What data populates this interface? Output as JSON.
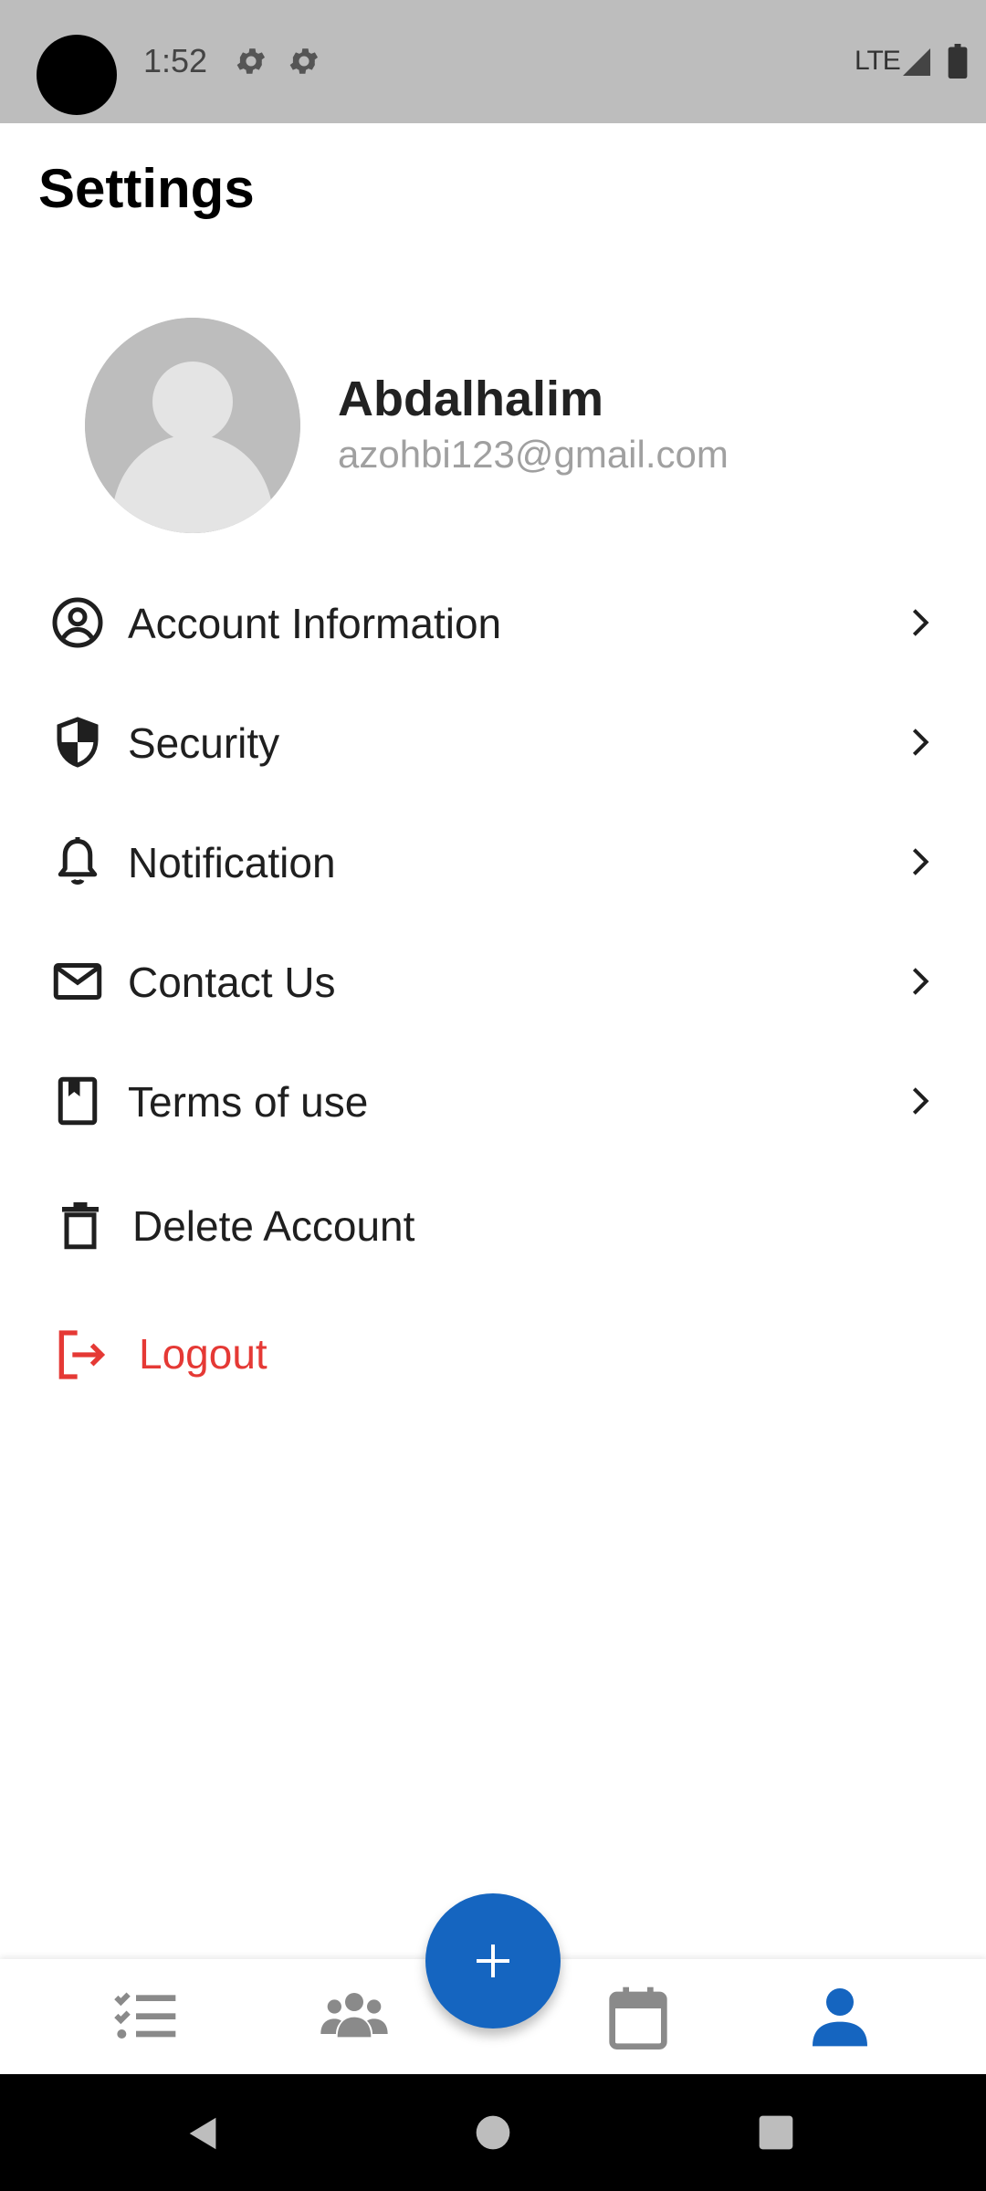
{
  "status_bar": {
    "time": "1:52",
    "network": "LTE",
    "icons": [
      "settings-icon",
      "settings-icon",
      "signal-icon",
      "battery-icon"
    ]
  },
  "page": {
    "title": "Settings"
  },
  "profile": {
    "name": "Abdalhalim",
    "email": "azohbi123@gmail.com",
    "avatar": "default-avatar"
  },
  "menu": {
    "items": [
      {
        "label": "Account Information",
        "icon": "account-circle-icon"
      },
      {
        "label": "Security",
        "icon": "shield-icon"
      },
      {
        "label": "Notification",
        "icon": "bell-icon"
      },
      {
        "label": "Contact Us",
        "icon": "mail-icon"
      },
      {
        "label": "Terms of use",
        "icon": "book-icon"
      },
      {
        "label": "Delete Account",
        "icon": "trash-icon"
      },
      {
        "label": "Logout",
        "icon": "logout-icon"
      }
    ]
  },
  "bottom_nav": {
    "items": [
      "tasks-icon",
      "group-icon",
      "add-icon",
      "calendar-icon",
      "person-icon"
    ],
    "active": "person-icon"
  },
  "colors": {
    "accent": "#1565c0",
    "logout": "#e53935",
    "status_bar": "#bdbdbd",
    "inactive_icon": "#8a8a8a"
  }
}
